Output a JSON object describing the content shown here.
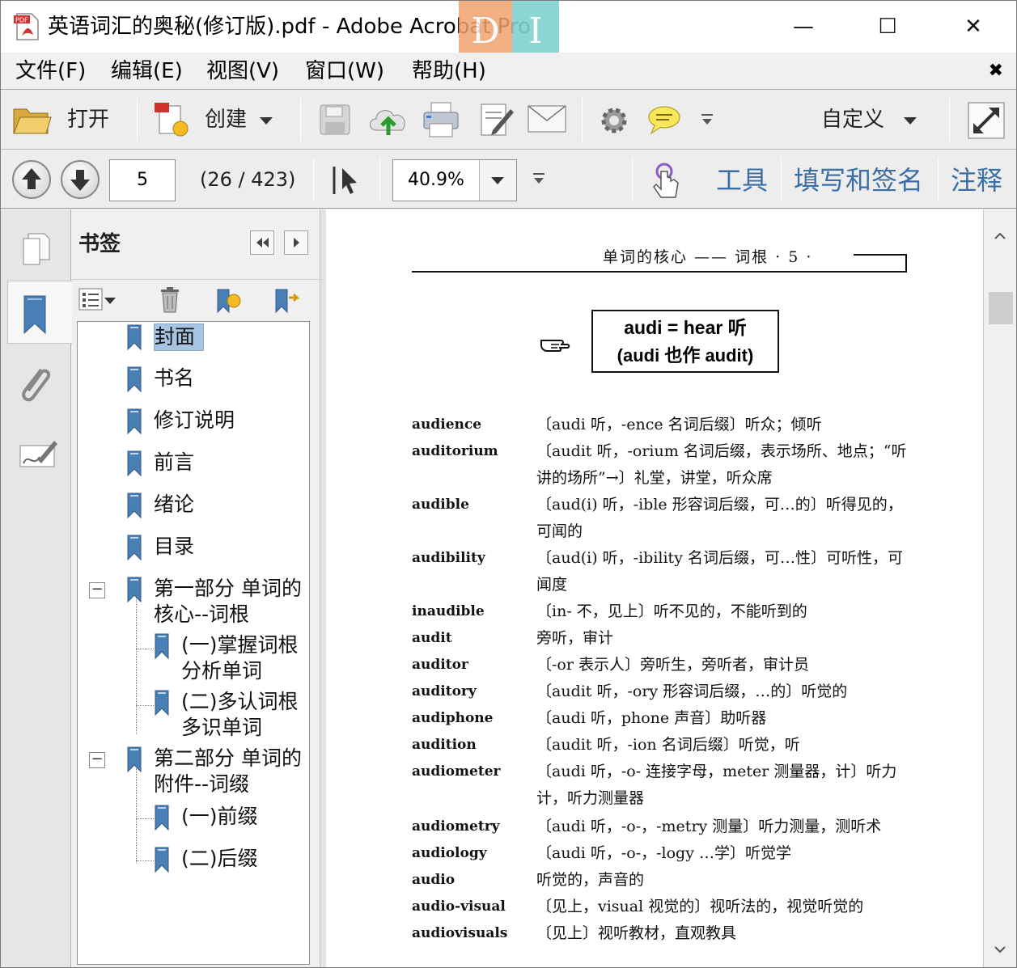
{
  "window": {
    "title": "英语词汇的奥秘(修订版).pdf - Adobe Acrobat Pro",
    "overlay_d": "D",
    "overlay_i": "I",
    "minimize": "—",
    "maximize": "☐",
    "close": "✕"
  },
  "menu": {
    "items": [
      "文件(F)",
      "编辑(E)",
      "视图(V)",
      "窗口(W)",
      "帮助(H)"
    ],
    "close_glyph": "✖"
  },
  "toolbar": {
    "open_label": "打开",
    "create_label": "创建",
    "customize_label": "自定义"
  },
  "nav": {
    "page_value": "5",
    "page_count": "(26 / 423)",
    "zoom_value": "40.9%",
    "tools_label": "工具",
    "fill_sign_label": "填写和签名",
    "comment_label": "注释"
  },
  "bookmarks": {
    "title": "书签",
    "items": [
      {
        "label": "封面"
      },
      {
        "label": "书名"
      },
      {
        "label": "修订说明"
      },
      {
        "label": "前言"
      },
      {
        "label": "绪论"
      },
      {
        "label": "目录"
      },
      {
        "label_line1": "第一部分 单词的",
        "label_line2": "核心--词根"
      },
      {
        "label_line1": "(一)掌握词根",
        "label_line2": "分析单词"
      },
      {
        "label_line1": "(二)多认词根",
        "label_line2": "多识单词"
      },
      {
        "label_line1": "第二部分 单词的",
        "label_line2": "附件--词缀"
      },
      {
        "label": "(一)前缀"
      },
      {
        "label": "(二)后缀"
      }
    ],
    "collapse_glyph": "−"
  },
  "document": {
    "running_header": "单词的核心 —— 词根  · 5 ·",
    "root_line1": "audi  =  hear 听",
    "root_line2": "(audi 也作 audit)",
    "entries": [
      {
        "word": "audience",
        "def": "〔audi 听，-ence 名词后缀〕听众；倾听"
      },
      {
        "word": "auditorium",
        "def": "〔audit 听，-orium 名词后缀，表示场所、地点；“听讲的场所”→〕礼堂，讲堂，听众席"
      },
      {
        "word": "audible",
        "def": "〔aud(i) 听，-ible 形容词后缀，可…的〕听得见的，可闻的"
      },
      {
        "word": "audibility",
        "def": "〔aud(i) 听，-ibility 名词后缀，可…性〕可听性，可闻度"
      },
      {
        "word": "inaudible",
        "def": "〔in- 不，见上〕听不见的，不能听到的"
      },
      {
        "word": "audit",
        "def": "旁听，审计"
      },
      {
        "word": "auditor",
        "def": "〔-or 表示人〕旁听生，旁听者，审计员"
      },
      {
        "word": "auditory",
        "def": "〔audit 听，-ory 形容词后缀，…的〕听觉的"
      },
      {
        "word": "audiphone",
        "def": "〔audi 听，phone 声音〕助听器"
      },
      {
        "word": "audition",
        "def": "〔audit 听，-ion 名词后缀〕听觉，听"
      },
      {
        "word": "audiometer",
        "def": "〔audi 听，-o- 连接字母，meter 测量器，计〕听力计，听力测量器"
      },
      {
        "word": "audiometry",
        "def": "〔audi 听，-o-，-metry 测量〕听力测量，测听术"
      },
      {
        "word": "audiology",
        "def": "〔audi 听，-o-，-logy …学〕听觉学"
      },
      {
        "word": "audio",
        "def": "听觉的，声音的"
      },
      {
        "word": "audio-visual",
        "def": "〔见上，visual 视觉的〕视听法的，视觉听觉的"
      },
      {
        "word": "audiovisuals",
        "def": "〔见上〕视听教材，直观教具"
      }
    ]
  },
  "colors": {
    "accent_link": "#3a6ea5",
    "selection": "#a7c5e3",
    "overlay_orange": "#f0a36d",
    "overlay_teal": "#7fd1cf"
  }
}
